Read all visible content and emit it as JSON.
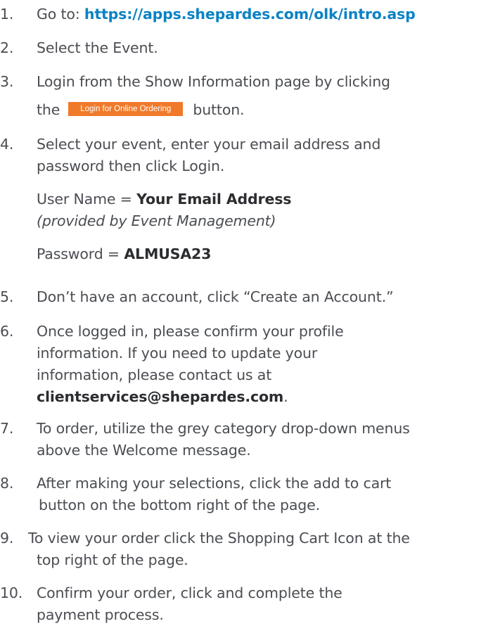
{
  "steps": [
    {
      "num": "1.",
      "prefix": "Go to: ",
      "link": "https://apps.shepardes.com/olk/intro.asp"
    },
    {
      "num": "2.",
      "text": "Select the Event."
    },
    {
      "num": "3.",
      "line1": "Login from the Show Information page by clicking",
      "line2_before": "the",
      "button_label": "Login for Online Ordering",
      "line2_after": "button."
    },
    {
      "num": "4.",
      "line1": "Select your event, enter your email address and",
      "line2": "password then click Login.",
      "username_label": "User Name = ",
      "username_value": "Your Email Address",
      "username_note": "(provided by Event Management)",
      "password_label": "Password = ",
      "password_value": "ALMUSA23"
    },
    {
      "num": "5.",
      "text": "Don’t have an account, click “Create an Account.”"
    },
    {
      "num": "6.",
      "line1": "Once logged in, please confirm your profile",
      "line2": "information. If you need to update your",
      "line3": "information, please contact us at",
      "email": "clientservices@shepardes.com",
      "email_after": "."
    },
    {
      "num": "7.",
      "line1": "To order, utilize the grey category drop-down menus",
      "line2": "above the Welcome message."
    },
    {
      "num": "8.",
      "line1": "After making your selections, click the add to cart",
      "line2": "button on the bottom right of the page."
    },
    {
      "num": "9.",
      "line1": "To view your order click the Shopping Cart Icon at the",
      "line2": "top right of the page."
    },
    {
      "num": "10.",
      "line1": "Confirm your order, click and complete the",
      "line2": "payment process."
    }
  ]
}
